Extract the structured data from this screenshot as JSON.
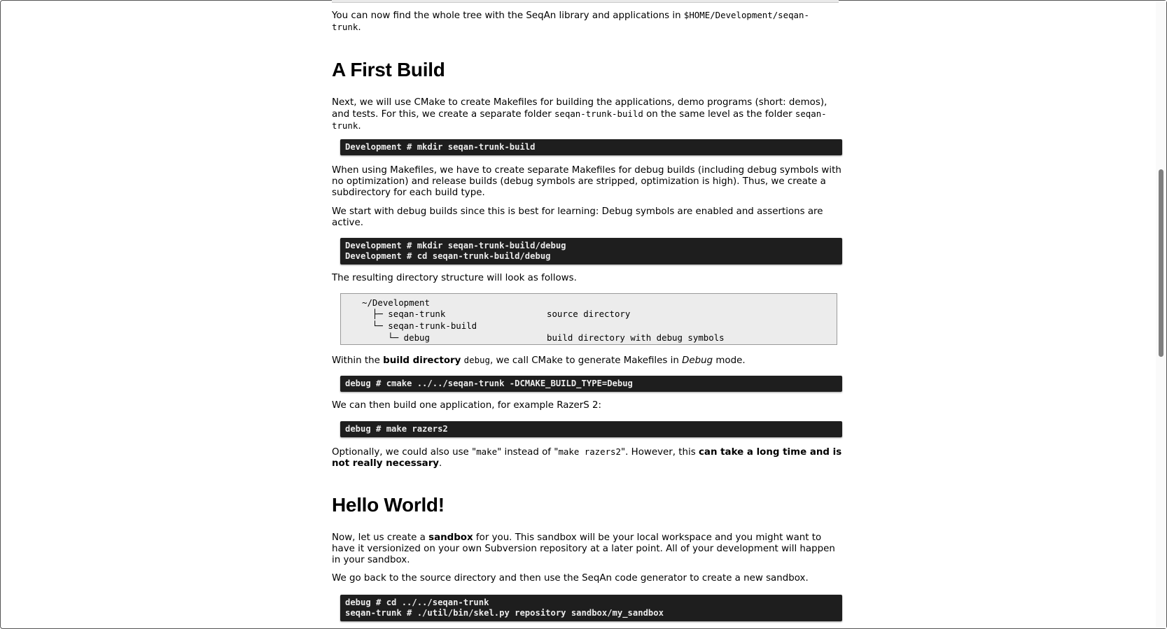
{
  "intro": {
    "text": "You can now find the whole tree with the SeqAn library and applications in",
    "path_a": "$HOME/Development/seqan-",
    "path_b": "trunk",
    "end": "."
  },
  "section_build": {
    "heading": "A First Build",
    "p1_line1": "Next, we will use CMake to create Makefiles for building the applications, demo programs (short: demos),",
    "p1_line2_a": "and tests. For this, we create a separate folder",
    "p1_code1": "seqan-trunk-build",
    "p1_line2_b": "on the same level as the folder",
    "p1_code2a": "seqan-",
    "p1_code2b": "trunk",
    "p1_end": ".",
    "cmd1": "Development # mkdir seqan-trunk-build",
    "p2_line1": "When using Makefiles, we have to create separate Makefiles for debug builds (including debug symbols with",
    "p2_line2": "no optimization) and release builds (debug symbols are stripped, optimization is high). Thus, we create a",
    "p2_line3": "subdirectory for each build type.",
    "p3_line1": "We start with debug builds since this is best for learning: Debug symbols are enabled and assertions are",
    "p3_line2": "active.",
    "cmd2_line1": "Development # mkdir seqan-trunk-build/debug",
    "cmd2_line2": "Development # cd seqan-trunk-build/debug",
    "p4": "The resulting directory structure will look as follows.",
    "tree": {
      "r1": "~/Development",
      "r2": "  ├─ seqan-trunk",
      "r2_desc": "source directory",
      "r3": "  └─ seqan-trunk-build",
      "r4": "     └─ debug",
      "r4_desc": "build directory with debug symbols"
    },
    "p5_a": "Within the",
    "p5_bold": "build directory",
    "p5_code": "debug",
    "p5_b": ", we call CMake to generate Makefiles in",
    "p5_em": "Debug",
    "p5_c": "mode.",
    "cmd3": "debug # cmake ../../seqan-trunk -DCMAKE_BUILD_TYPE=Debug",
    "p6": "We can then build one application, for example RazerS 2:",
    "cmd4": "debug # make razers2",
    "p7_a": "Optionally, we could also use \"",
    "p7_code1": "make",
    "p7_b": "\" instead of \"",
    "p7_code2": "make razers2",
    "p7_c": "\". However, this",
    "p7_bold1": "can take a long time and is",
    "p7_bold2": "not really necessary",
    "p7_end": "."
  },
  "section_hello": {
    "heading": "Hello World!",
    "p1_a": "Now, let us create a",
    "p1_bold": "sandbox",
    "p1_b": "for you. This sandbox will be your local workspace and you might want to",
    "p1_line2": "have it versionized on your own Subversion repository at a later point. All of your development will happen",
    "p1_line3": "in your sandbox.",
    "p2": "We go back to the source directory and then use the SeqAn code generator to create a new sandbox.",
    "cmd_line1": "debug # cd ../../seqan-trunk",
    "cmd_line2": "seqan-trunk # ./util/bin/skel.py repository sandbox/my_sandbox"
  }
}
